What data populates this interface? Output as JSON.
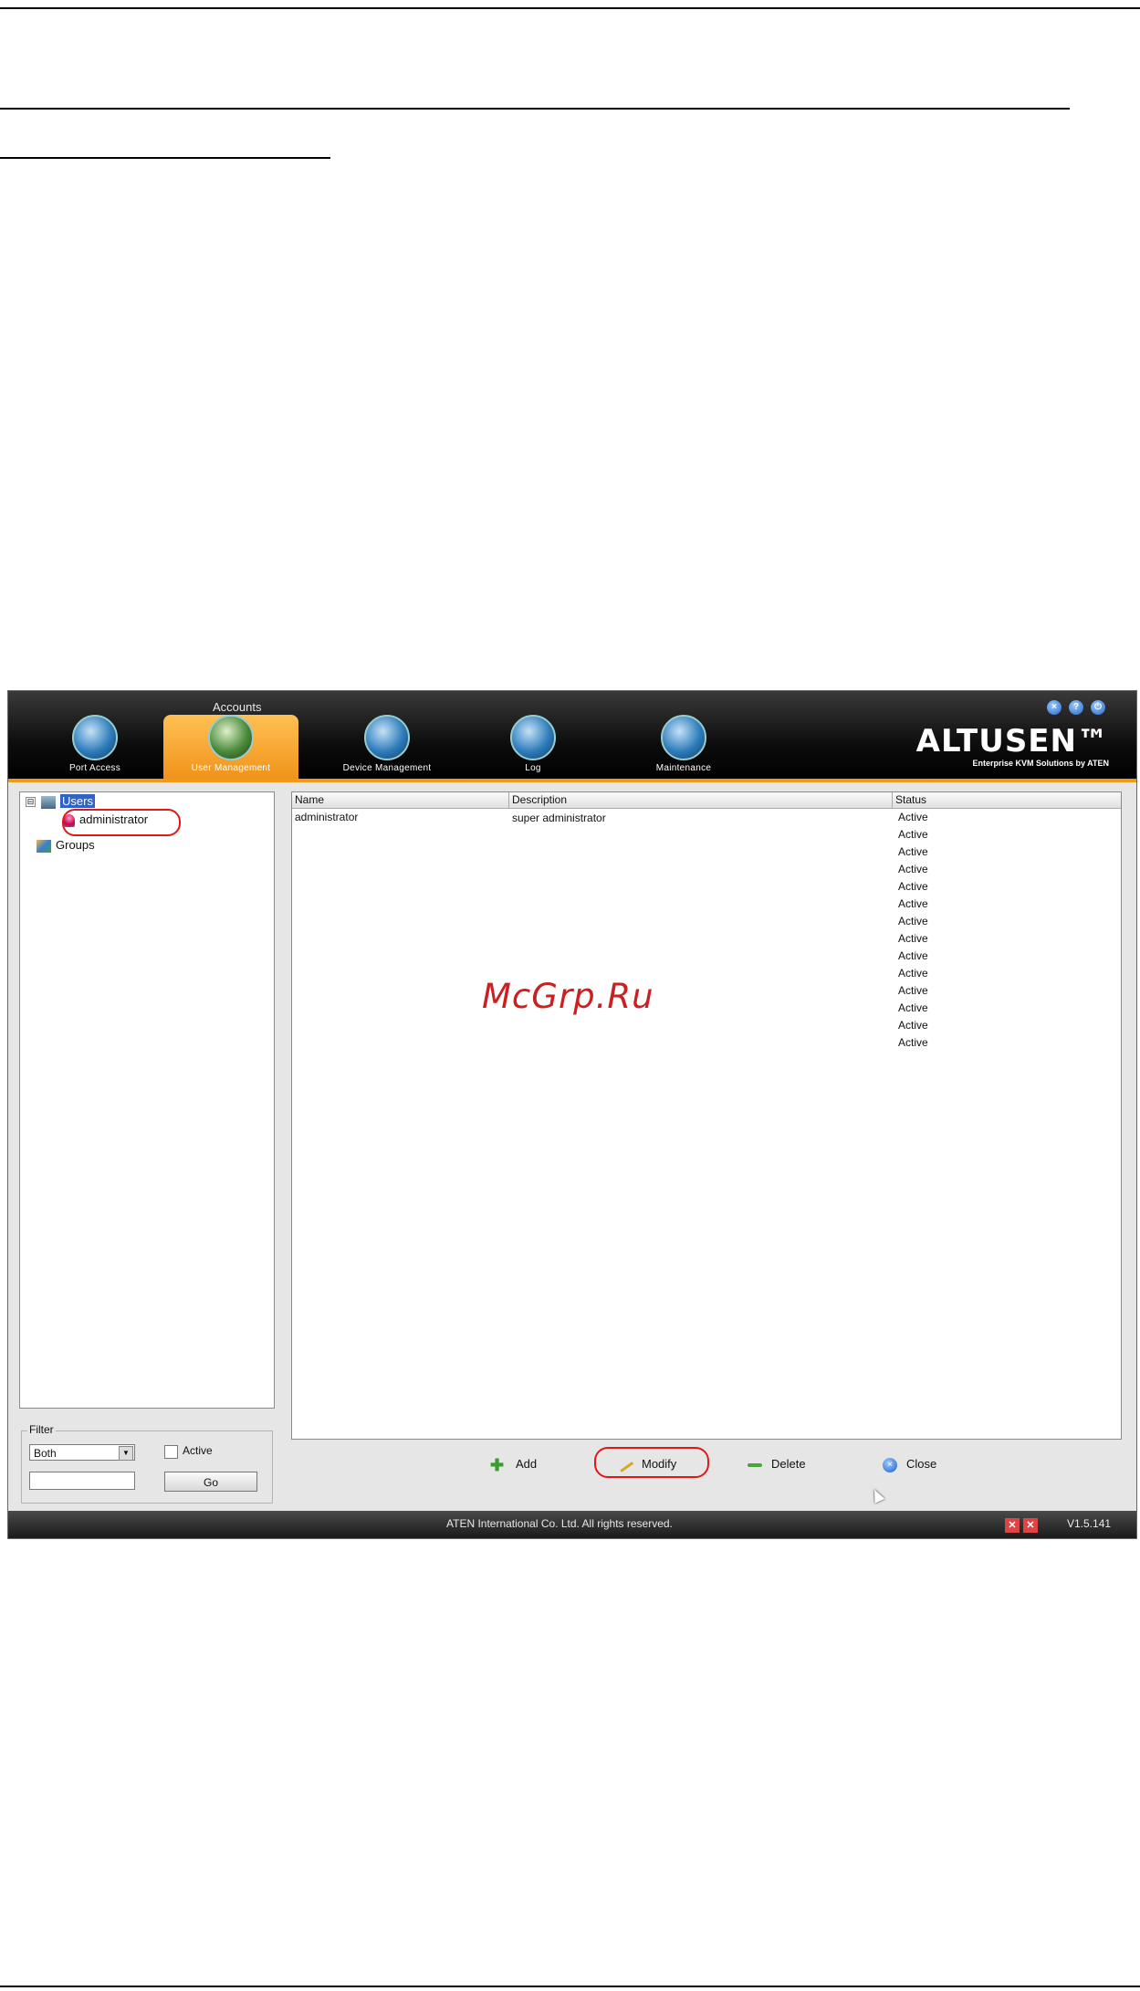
{
  "watermark": "McGrp.Ru",
  "app": {
    "header": {
      "section_label": "Accounts",
      "tabs": [
        {
          "label": "Port Access",
          "icon": "port-access-icon"
        },
        {
          "label": "User Management",
          "icon": "user-management-icon",
          "active": true
        },
        {
          "label": "Device Management",
          "icon": "device-management-icon"
        },
        {
          "label": "Log",
          "icon": "log-icon"
        },
        {
          "label": "Maintenance",
          "icon": "maintenance-icon"
        }
      ],
      "brand_name": "ALTUSEN™",
      "brand_tagline": "Enterprise KVM Solutions by ATEN",
      "window_buttons": [
        "close-icon",
        "help-icon",
        "logout-icon"
      ]
    },
    "tree": {
      "expander": "⊟",
      "users_label": "Users",
      "admin_label": "administrator",
      "groups_label": "Groups"
    },
    "filter": {
      "legend": "Filter",
      "select_value": "Both",
      "active_label": "Active",
      "input_value": "",
      "go_label": "Go"
    },
    "table": {
      "columns": [
        "Name",
        "Description",
        "Status"
      ],
      "rows": [
        {
          "name": "administrator",
          "description": "super administrator",
          "status": "Active"
        }
      ],
      "extra_status": [
        "Active",
        "Active",
        "Active",
        "Active",
        "Active",
        "Active",
        "Active",
        "Active",
        "Active",
        "Active",
        "Active",
        "Active",
        "Active"
      ]
    },
    "actions": {
      "add_label": "Add",
      "modify_label": "Modify",
      "delete_label": "Delete",
      "close_label": "Close"
    },
    "statusbar": {
      "copyright": "ATEN International Co. Ltd. All rights reserved.",
      "version": "V1.5.141"
    }
  },
  "colors": {
    "accent_orange": "#f09a1b",
    "highlight_red": "#e01818",
    "selection_blue": "#3163c4"
  }
}
